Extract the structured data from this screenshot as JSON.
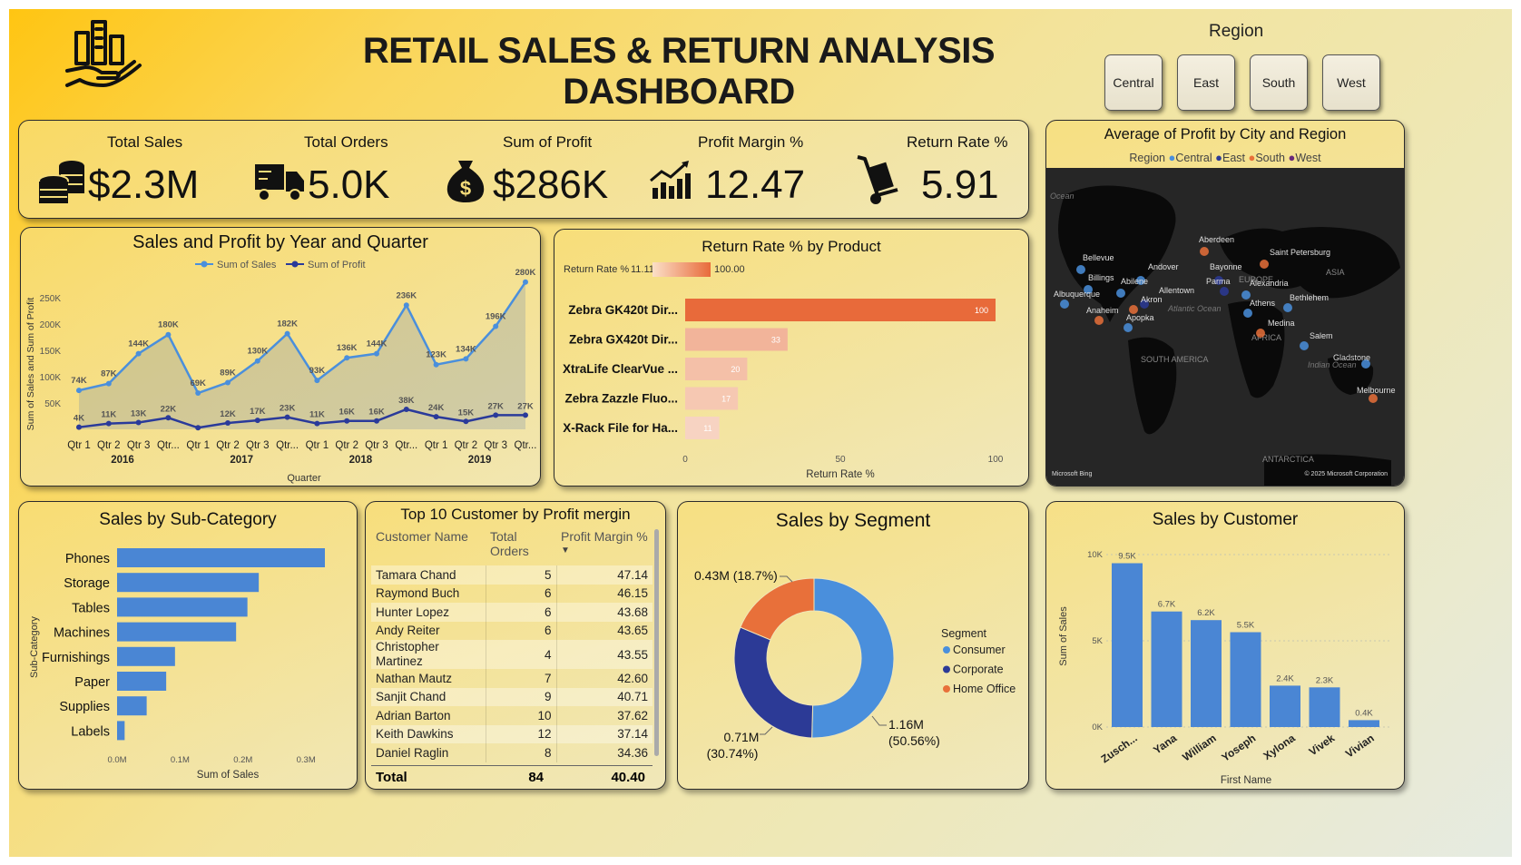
{
  "header": {
    "title": "RETAIL SALES & RETURN ANALYSIS DASHBOARD"
  },
  "region_filter": {
    "label": "Region",
    "options": [
      "Central",
      "East",
      "South",
      "West"
    ]
  },
  "kpis": [
    {
      "label": "Total Sales",
      "value": "$2.3M",
      "icon": "coins-icon"
    },
    {
      "label": "Total Orders",
      "value": "5.0K",
      "icon": "truck-icon"
    },
    {
      "label": "Sum of Profit",
      "value": "$286K",
      "icon": "money-bag-icon"
    },
    {
      "label": "Profit Margin %",
      "value": "12.47",
      "icon": "growth-chart-icon"
    },
    {
      "label": "Return Rate %",
      "value": "5.91",
      "icon": "hand-truck-icon"
    }
  ],
  "colors": {
    "sales": "#4a8fdc",
    "profit": "#2a3a9a",
    "accent": "#e86a3a",
    "bar": "#4a86d4",
    "consumer": "#4a8fdc",
    "corporate": "#2c3a96",
    "home_office": "#e8703a"
  },
  "line_chart": {
    "title": "Sales and Profit by Year and Quarter",
    "chart_data": {
      "type": "line",
      "title": "Sales and Profit by Year and Quarter",
      "xlabel": "Quarter",
      "ylabel": "Sum of Sales and Sum of Profit",
      "years": [
        "2016",
        "2017",
        "2018",
        "2019"
      ],
      "categories": [
        "Qtr 1",
        "Qtr 2",
        "Qtr 3",
        "Qtr...",
        "Qtr 1",
        "Qtr 2",
        "Qtr 3",
        "Qtr...",
        "Qtr 1",
        "Qtr 2",
        "Qtr 3",
        "Qtr...",
        "Qtr 1",
        "Qtr 2",
        "Qtr 3",
        "Qtr..."
      ],
      "series": [
        {
          "name": "Sum of Sales",
          "values": [
            74,
            87,
            144,
            180,
            69,
            89,
            130,
            182,
            93,
            136,
            144,
            236,
            123,
            134,
            196,
            280
          ],
          "labels": [
            "74K",
            "87K",
            "144K",
            "180K",
            "69K",
            "89K",
            "130K",
            "182K",
            "93K",
            "136K",
            "144K",
            "236K",
            "123K",
            "134K",
            "196K",
            "280K"
          ]
        },
        {
          "name": "Sum of Profit",
          "values": [
            4,
            11,
            13,
            22,
            3,
            12,
            17,
            23,
            11,
            16,
            16,
            38,
            24,
            15,
            27,
            27
          ],
          "labels": [
            "4K",
            "11K",
            "13K",
            "22K",
            "",
            "12K",
            "17K",
            "23K",
            "11K",
            "16K",
            "16K",
            "38K",
            "24K",
            "15K",
            "27K",
            "27K"
          ]
        }
      ],
      "yticks": [
        "50K",
        "100K",
        "150K",
        "200K",
        "250K"
      ],
      "ylim": [
        0,
        290
      ]
    }
  },
  "return_chart": {
    "title": "Return Rate % by Product",
    "legend": {
      "label": "Return Rate %",
      "min": "11.11",
      "max": "100.00"
    },
    "chart_data": {
      "type": "bar",
      "title": "Return Rate % by Product",
      "xlabel": "Return Rate %",
      "categories": [
        "Zebra GK420t Dir...",
        "Zebra GX420t Dir...",
        "XtraLife ClearVue ...",
        "Zebra Zazzle Fluo...",
        "X-Rack File for Ha..."
      ],
      "values": [
        100,
        33,
        20,
        17,
        11
      ],
      "labels": [
        "100",
        "33",
        "20",
        "17",
        "11"
      ],
      "xticks": [
        "0",
        "50",
        "100"
      ],
      "xlim": [
        0,
        100
      ]
    }
  },
  "map": {
    "title": "Average of Profit by City and Region",
    "legend_label": "Region",
    "legend": [
      {
        "name": "Central",
        "color": "#4a8fdc"
      },
      {
        "name": "East",
        "color": "#2c3a96"
      },
      {
        "name": "South",
        "color": "#e8703a"
      },
      {
        "name": "West",
        "color": "#6a2a7a"
      }
    ],
    "cities": [
      "Aberdeen",
      "Saint Petersburg",
      "Bellevue",
      "Andover",
      "Bayonne",
      "Billings",
      "Abilene",
      "Allentown",
      "Parma",
      "Alexandria",
      "Albuquerque",
      "Akron",
      "Athens",
      "Bethlehem",
      "Anaheim",
      "Apopka",
      "Medina",
      "Salem",
      "Gladstone",
      "Melbourne"
    ],
    "regions": [
      "SOUTH AMERICA",
      "AFRICA",
      "EUROPE",
      "ASIA",
      "ANTARCTICA"
    ],
    "water": [
      "Ocean",
      "Atlantic Ocean",
      "Indian Ocean"
    ],
    "credit_left": "Microsoft Bing",
    "credit_right": "© 2025 Microsoft Corporation"
  },
  "subcat_chart": {
    "title": "Sales by Sub-Category",
    "chart_data": {
      "type": "bar",
      "title": "Sales by Sub-Category",
      "xlabel": "Sum of Sales",
      "ylabel": "Sub-Category",
      "categories": [
        "Phones",
        "Storage",
        "Tables",
        "Machines",
        "Furnishings",
        "Paper",
        "Supplies",
        "Labels"
      ],
      "values": [
        0.33,
        0.225,
        0.207,
        0.189,
        0.092,
        0.078,
        0.047,
        0.012
      ],
      "xticks": [
        "0.0M",
        "0.1M",
        "0.2M",
        "0.3M"
      ],
      "xlim": [
        0,
        0.36
      ]
    }
  },
  "customer_table": {
    "title": "Top 10 Customer by Profit mergin",
    "columns": [
      "Customer Name",
      "Total Orders",
      "Profit Margin %"
    ],
    "rows": [
      [
        "Tamara Chand",
        "5",
        "47.14"
      ],
      [
        "Raymond Buch",
        "6",
        "46.15"
      ],
      [
        "Hunter Lopez",
        "6",
        "43.68"
      ],
      [
        "Andy Reiter",
        "6",
        "43.65"
      ],
      [
        "Christopher Martinez",
        "4",
        "43.55"
      ],
      [
        "Nathan Mautz",
        "7",
        "42.60"
      ],
      [
        "Sanjit Chand",
        "9",
        "40.71"
      ],
      [
        "Adrian Barton",
        "10",
        "37.62"
      ],
      [
        "Keith Dawkins",
        "12",
        "37.14"
      ],
      [
        "Daniel Raglin",
        "8",
        "34.36"
      ]
    ],
    "total": [
      "Total",
      "84",
      "40.40"
    ]
  },
  "segment_chart": {
    "title": "Sales by Segment",
    "legend_title": "Segment",
    "chart_data": {
      "type": "pie",
      "title": "Sales by Segment",
      "categories": [
        "Consumer",
        "Corporate",
        "Home Office"
      ],
      "values": [
        1.16,
        0.71,
        0.43
      ],
      "percent": [
        50.56,
        30.74,
        18.7
      ],
      "labels": [
        "1.16M",
        "0.71M",
        "0.43M"
      ],
      "percent_labels": [
        "(50.56%)",
        "(30.74%)",
        "(18.7%)"
      ]
    }
  },
  "customer_chart": {
    "title": "Sales by Customer",
    "chart_data": {
      "type": "bar",
      "title": "Sales by Customer",
      "xlabel": "First Name",
      "ylabel": "Sum of Sales",
      "categories": [
        "Zusch...",
        "Yana",
        "William",
        "Yoseph",
        "Xylona",
        "Vivek",
        "Vivian"
      ],
      "values": [
        9.5,
        6.7,
        6.2,
        5.5,
        2.4,
        2.3,
        0.4
      ],
      "labels": [
        "9.5K",
        "6.7K",
        "6.2K",
        "5.5K",
        "2.4K",
        "2.3K",
        "0.4K"
      ],
      "yticks": [
        "0K",
        "5K",
        "10K"
      ],
      "ylim": [
        0,
        10
      ]
    }
  }
}
